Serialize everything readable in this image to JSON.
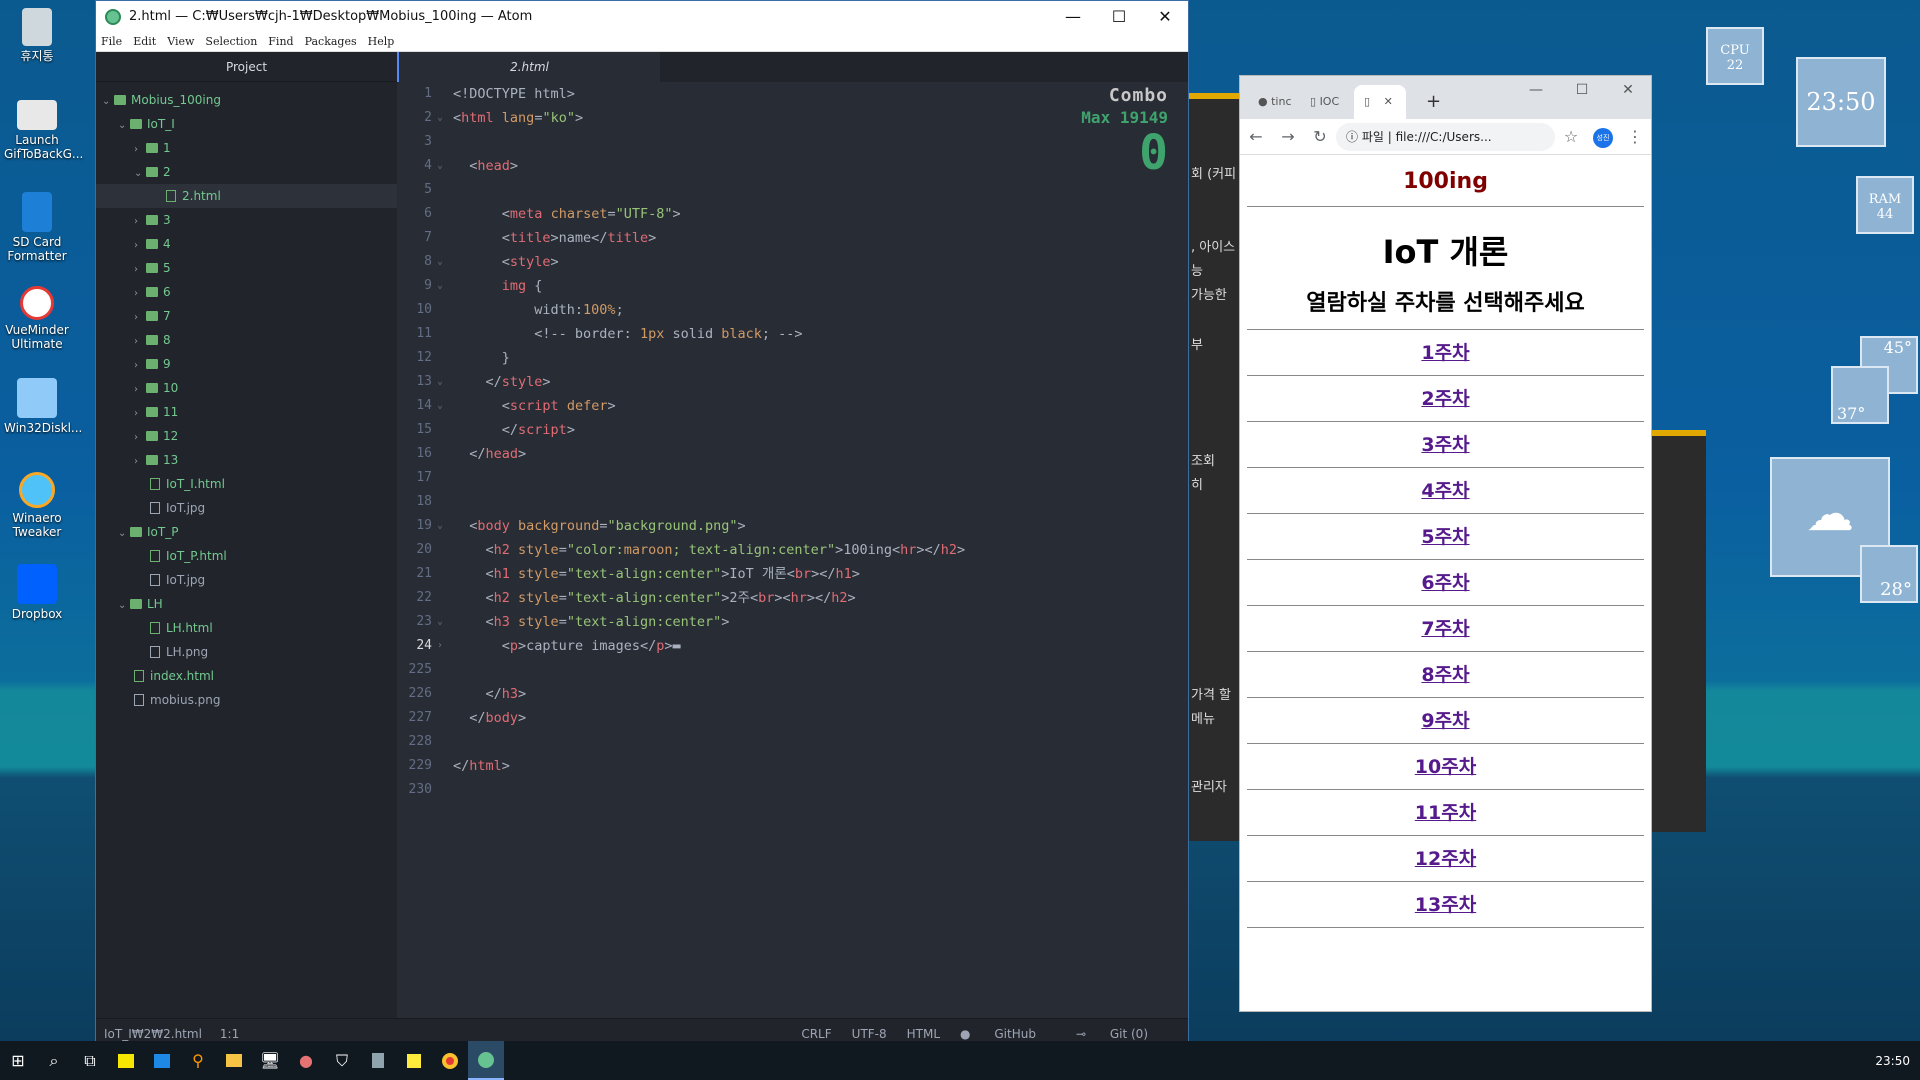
{
  "desktop": {
    "icons": [
      {
        "label": "휴지통"
      },
      {
        "label": "Launch GifToBackG..."
      },
      {
        "label": "SD Card Formatter"
      },
      {
        "label": "VueMinder Ultimate"
      },
      {
        "label": "Win32Diskl..."
      },
      {
        "label": "Winaero Tweaker"
      },
      {
        "label": "Dropbox"
      }
    ]
  },
  "atom": {
    "title": "2.html — C:₩Users₩cjh-1₩Desktop₩Mobius_100ing — Atom",
    "menu": [
      "File",
      "Edit",
      "View",
      "Selection",
      "Find",
      "Packages",
      "Help"
    ],
    "project_label": "Project",
    "tree": [
      {
        "label": "Mobius_100ing"
      },
      {
        "label": "IoT_I"
      },
      {
        "label": "1"
      },
      {
        "label": "2"
      },
      {
        "label": "2.html"
      },
      {
        "label": "3"
      },
      {
        "label": "4"
      },
      {
        "label": "5"
      },
      {
        "label": "6"
      },
      {
        "label": "7"
      },
      {
        "label": "8"
      },
      {
        "label": "9"
      },
      {
        "label": "10"
      },
      {
        "label": "11"
      },
      {
        "label": "12"
      },
      {
        "label": "13"
      },
      {
        "label": "IoT_I.html"
      },
      {
        "label": "IoT.jpg"
      },
      {
        "label": "IoT_P"
      },
      {
        "label": "IoT_P.html"
      },
      {
        "label": "IoT.jpg"
      },
      {
        "label": "LH"
      },
      {
        "label": "LH.html"
      },
      {
        "label": "LH.png"
      },
      {
        "label": "index.html"
      },
      {
        "label": "mobius.png"
      }
    ],
    "tab_label": "2.html",
    "combo": {
      "label": "Combo",
      "max": "Max 19149",
      "count": "0"
    },
    "line_numbers": [
      "1",
      "2",
      "3",
      "4",
      "5",
      "6",
      "7",
      "8",
      "9",
      "10",
      "11",
      "12",
      "13",
      "14",
      "15",
      "16",
      "17",
      "18",
      "19",
      "20",
      "21",
      "22",
      "23",
      "24",
      "225",
      "226",
      "227",
      "228",
      "229",
      "230"
    ],
    "status": {
      "path": "IoT_I₩2₩2.html",
      "cursor": "1:1",
      "line_ending": "CRLF",
      "encoding": "UTF-8",
      "grammar": "HTML",
      "github": "GitHub",
      "git": "Git (0)"
    }
  },
  "chrome": {
    "tab1": "tinc",
    "tab2": "IOC",
    "new_tab": "+",
    "url_prefix": "파일",
    "url": "file:///C:/Users...",
    "profile": "성진",
    "page": {
      "h2_brand": "100ing",
      "h1": "IoT 개론",
      "h2_sub": "열람하실 주차를 선택해주세요",
      "weeks": [
        "1주차",
        "2주차",
        "3주차",
        "4주차",
        "5주차",
        "6주차",
        "7주차",
        "8주차",
        "9주차",
        "10주차",
        "11주차",
        "12주차",
        "13주차"
      ]
    }
  },
  "background_text": [
    "회 (커피",
    ", 아이스",
    "능",
    "가능한",
    "부",
    "조회",
    "히",
    "가격 할",
    "메뉴",
    "관리자"
  ],
  "widgets": {
    "cpu_label": "CPU",
    "cpu_value": "22",
    "clock": "23:50",
    "ram_label": "RAM",
    "ram_value": "44",
    "temp1": "45°",
    "temp2": "37°",
    "temp3": "28°"
  },
  "taskbar": {
    "clock": "23:50"
  }
}
